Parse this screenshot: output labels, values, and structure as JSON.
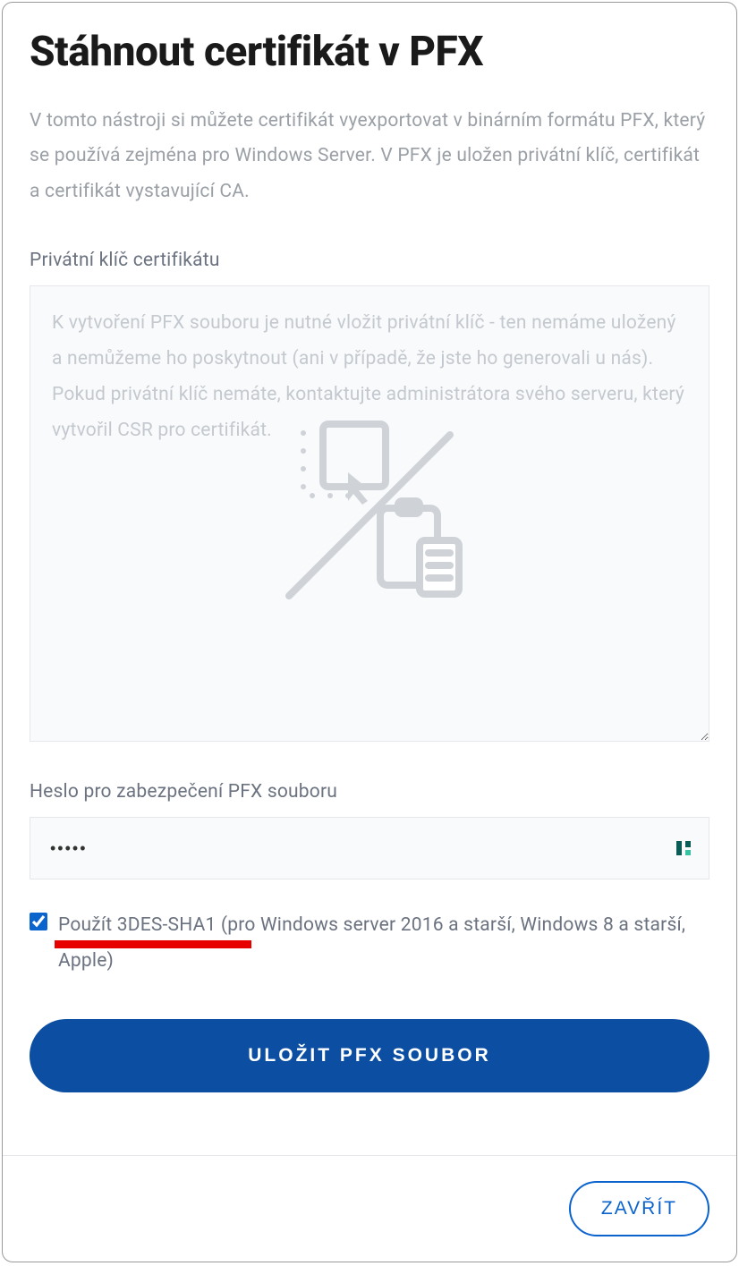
{
  "modal": {
    "title": "Stáhnout certifikát v PFX",
    "description": "V tomto nástroji si můžete certifikát vyexportovat v binárním formátu PFX, který se používá zejména pro Windows Server. V PFX je uložen privátní klíč, certifikát a certifikát vystavující CA.",
    "private_key": {
      "label": "Privátní klíč certifikátu",
      "placeholder": "K vytvoření PFX souboru je nutné vložit privátní klíč - ten nemáme uložený a nemůžeme ho poskytnout (ani v případě, že jste ho generovali u nás). Pokud privátní klíč nemáte, kontaktujte administrátora svého serveru, který vytvořil CSR pro certifikát.",
      "value": ""
    },
    "password": {
      "label": "Heslo pro zabezpečení PFX souboru",
      "value": "•••••"
    },
    "option_3des": {
      "checked": true,
      "label": "Použít 3DES-SHA1 (pro Windows server 2016 a starší, Windows 8 a starší, Apple)"
    },
    "submit_label": "ULOŽIT PFX SOUBOR",
    "close_label": "ZAVŘÍT"
  }
}
